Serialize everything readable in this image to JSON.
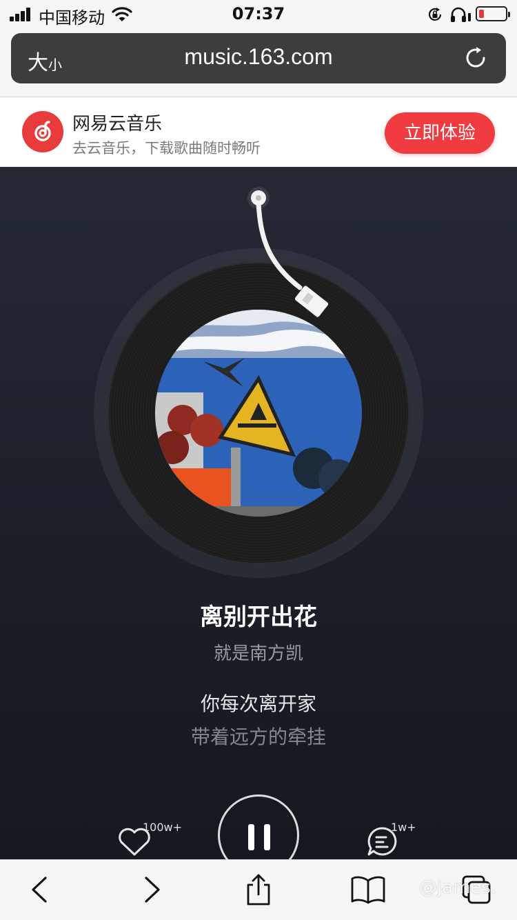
{
  "status_bar": {
    "carrier": "中国移动",
    "time": "07:37",
    "icons": [
      "signal-icon",
      "wifi-icon",
      "rotation-lock-icon",
      "headphones-icon",
      "battery-icon"
    ]
  },
  "address_bar": {
    "text_size_big": "大",
    "text_size_small": "小",
    "url": "music.163.com",
    "icons": [
      "reload-icon"
    ]
  },
  "app_banner": {
    "name": "网易云音乐",
    "description": "去云音乐，下载歌曲随时畅听",
    "cta_label": "立即体验",
    "brand_color": "#f03c40"
  },
  "player": {
    "song_title": "离别开出花",
    "artist": "就是南方凯",
    "lyric_current": "你每次离开家",
    "lyric_next": "带着远方的牵挂",
    "like_count": "100w+",
    "comment_count": "1w+",
    "state": "playing"
  },
  "toolbar": {
    "icons": [
      "back-icon",
      "forward-icon",
      "share-icon",
      "bookmarks-icon",
      "tabs-icon"
    ]
  },
  "watermark": "@james."
}
